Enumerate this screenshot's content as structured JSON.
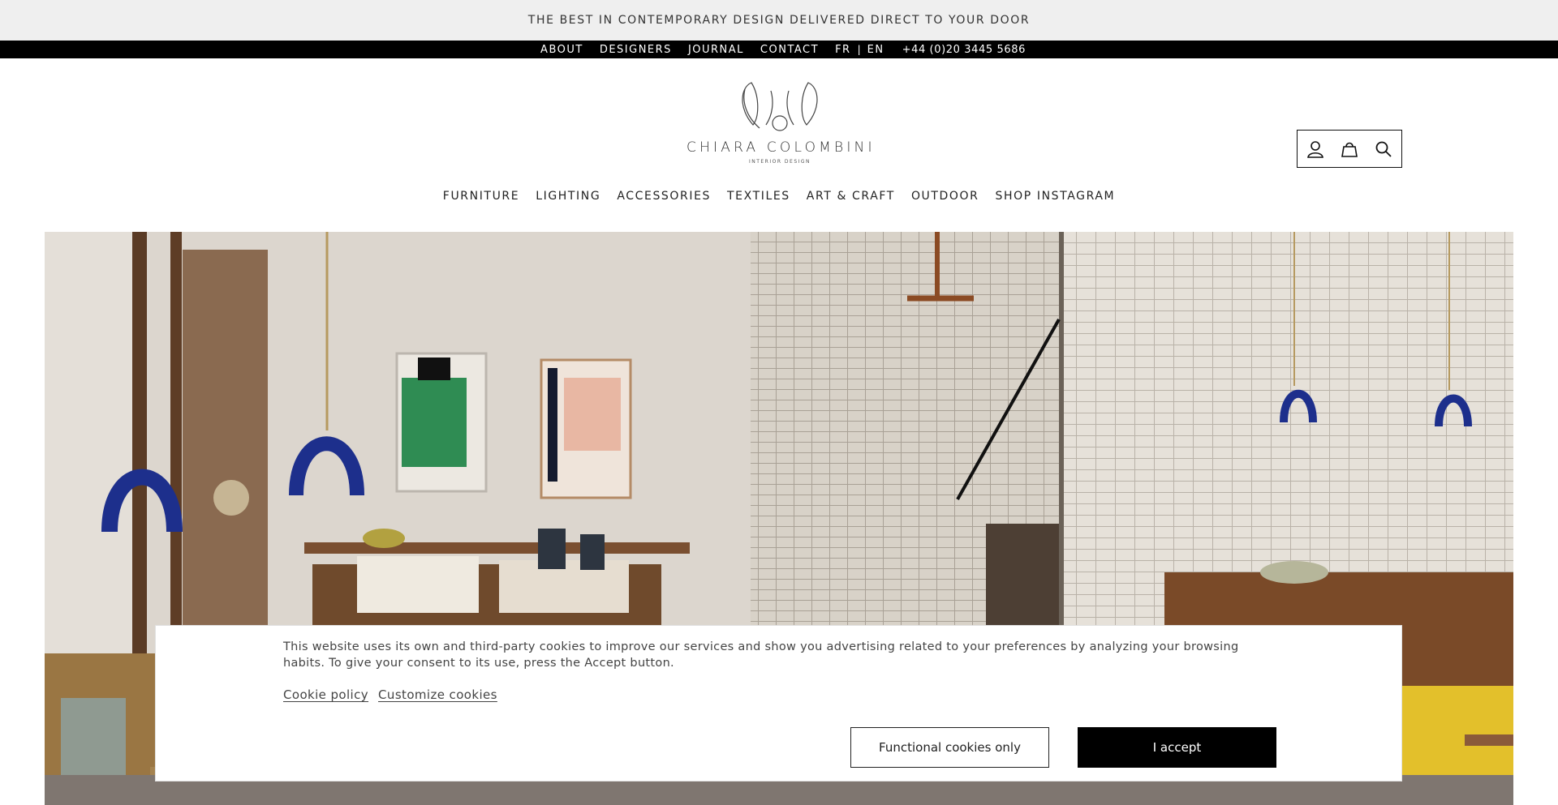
{
  "promo": {
    "text": "THE BEST IN CONTEMPORARY DESIGN DELIVERED DIRECT TO YOUR DOOR"
  },
  "utility_nav": {
    "about": "ABOUT",
    "designers": "DESIGNERS",
    "journal": "JOURNAL",
    "contact": "CONTACT",
    "lang_fr": "FR",
    "separator": "|",
    "lang_en": "EN",
    "phone": "+44 (0)20 3445 5686"
  },
  "logo": {
    "name": "CHIARA COLOMBINI",
    "tagline": "INTERIOR DESIGN"
  },
  "header_icons": [
    "user-icon",
    "shopping-bag-icon",
    "search-icon"
  ],
  "main_nav": [
    "FURNITURE",
    "LIGHTING",
    "ACCESSORIES",
    "TEXTILES",
    "ART & CRAFT",
    "OUTDOOR",
    "SHOP INSTAGRAM"
  ],
  "cookie_banner": {
    "message": "This website uses its own and third-party cookies to improve our services and show you advertising related to your preferences by analyzing your browsing habits. To give your consent to its use, press the Accept button.",
    "policy_link": "Cookie policy",
    "customize_link": "Customize cookies",
    "functional_button": "Functional cookies only",
    "accept_button": "I accept"
  },
  "colors": {
    "accent_blue": "#1d2f8c",
    "promo_bg": "#efefef",
    "utility_bg": "#000000"
  }
}
